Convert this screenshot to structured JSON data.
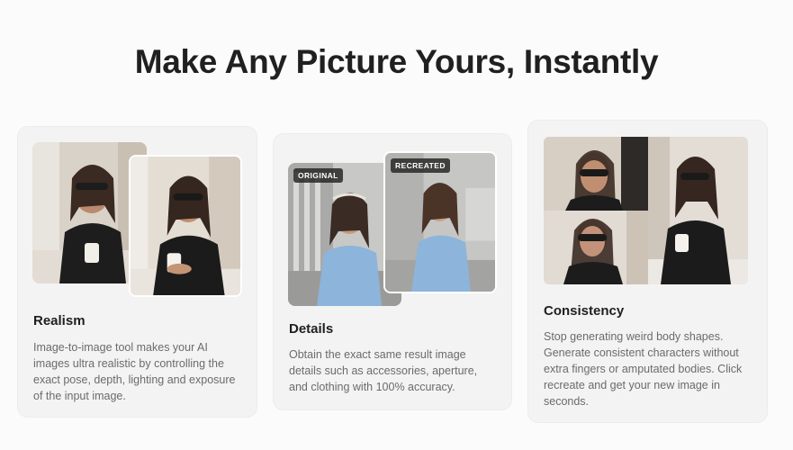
{
  "heading": "Make Any Picture Yours, Instantly",
  "cards": [
    {
      "title": "Realism",
      "description": "Image-to-image tool makes your AI images ultra realistic by controlling the exact pose, depth, lighting and exposure of the input image."
    },
    {
      "title": "Details",
      "description": "Obtain the exact same result image details such as accessories, aperture, and clothing with 100% accuracy.",
      "tags": {
        "original": "ORIGINAL",
        "recreated": "RECREATED"
      }
    },
    {
      "title": "Consistency",
      "description": "Stop generating weird body shapes. Generate consistent characters without extra fingers or amputated bodies. Click recreate and get your new image in seconds."
    }
  ],
  "colors": {
    "background": "#fbfbfc",
    "card": "#f3f3f4",
    "heading": "#202020",
    "body_text": "#6b6b6b",
    "dress_blue": "#8db4da"
  }
}
